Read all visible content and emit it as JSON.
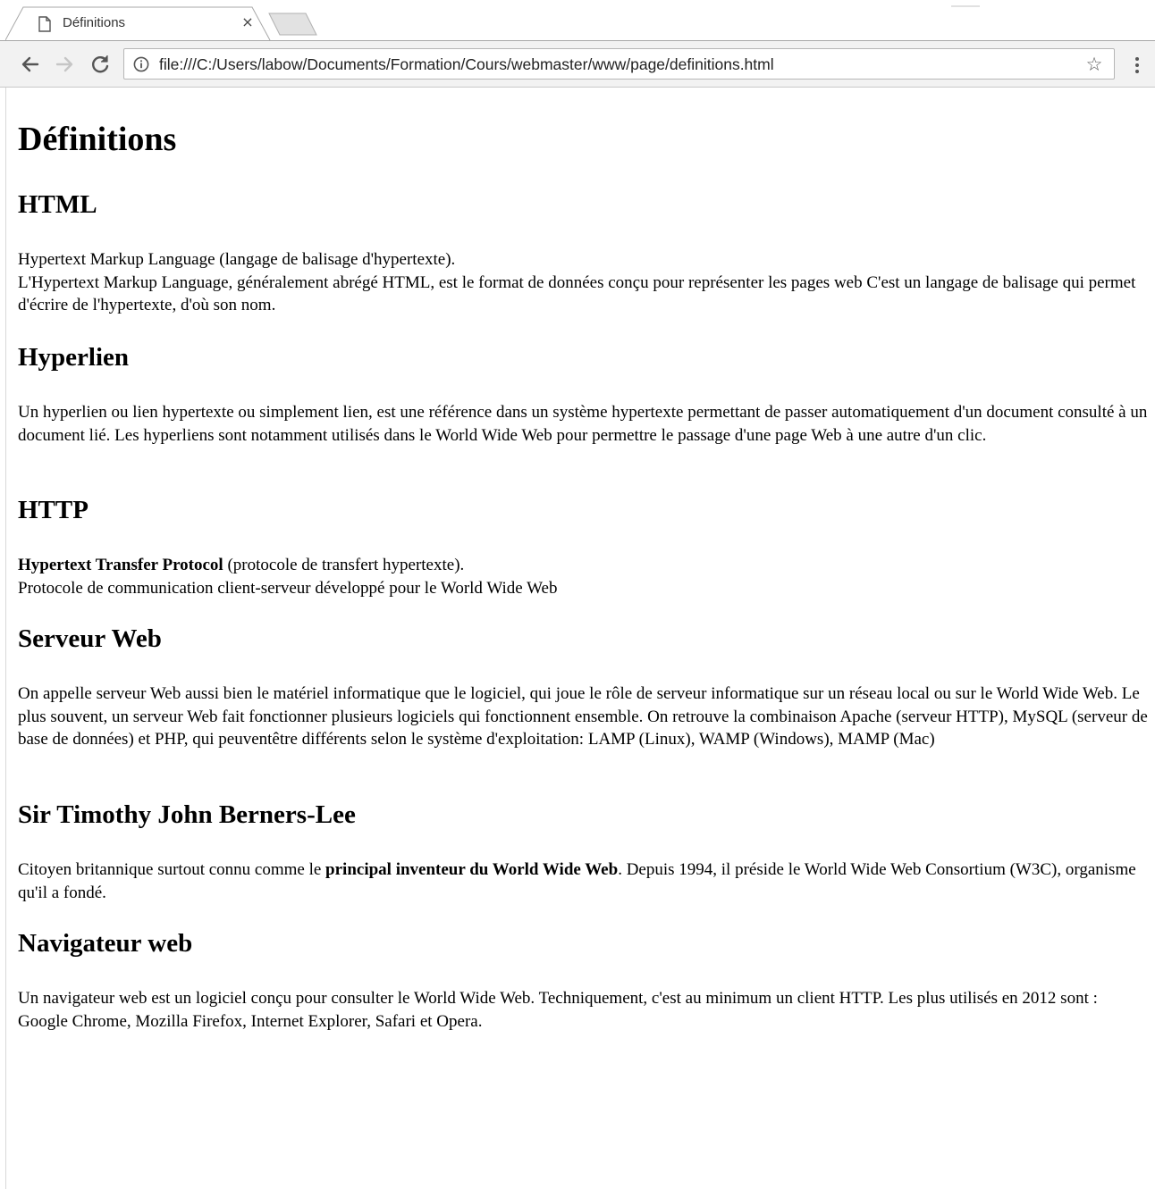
{
  "browser": {
    "tab_title": "Définitions",
    "tab_close": "×",
    "url": "file:///C:/Users/labow/Documents/Formation/Cours/webmaster/www/page/definitions.html",
    "icons": {
      "favicon": "document-icon",
      "back": "back-arrow-icon",
      "forward": "forward-arrow-icon",
      "reload": "reload-icon",
      "info": "info-icon",
      "bookmark": "star-icon",
      "menu": "kebab-menu-icon"
    }
  },
  "page": {
    "title": "Définitions",
    "sections": [
      {
        "heading": "HTML",
        "line1": "Hypertext Markup Language (langage de balisage d'hypertexte).",
        "line2": "L'Hypertext Markup Language, généralement abrégé HTML, est le format de données conçu pour représenter les pages web C'est un langage de balisage qui permet d'écrire de l'hypertexte, d'où son nom."
      },
      {
        "heading": "Hyperlien",
        "text": "Un hyperlien ou lien hypertexte ou simplement lien, est une référence dans un système hypertexte permettant de passer automatiquement d'un document consulté à un document lié. Les hyperliens sont notamment utilisés dans le World Wide Web pour permettre le passage d'une page Web à une autre d'un clic."
      },
      {
        "heading": "HTTP",
        "bold": "Hypertext Transfer Protocol",
        "line1_rest": " (protocole de transfert hypertexte).",
        "line2": "Protocole de communication client-serveur développé pour le World Wide Web"
      },
      {
        "heading": "Serveur Web",
        "text": "On appelle serveur Web aussi bien le matériel informatique que le logiciel, qui joue le rôle de serveur informatique sur un réseau local ou sur le World Wide Web. Le plus souvent, un serveur Web fait fonctionner plusieurs logiciels qui fonctionnent ensemble. On retrouve la combinaison Apache (serveur HTTP), MySQL (serveur de base de données) et PHP, qui peuventêtre différents selon le système d'exploitation: LAMP (Linux), WAMP (Windows), MAMP (Mac)"
      },
      {
        "heading": "Sir Timothy John Berners-Lee",
        "before": "Citoyen britannique surtout connu comme le ",
        "bold": "principal inventeur du World Wide Web",
        "after": ". Depuis 1994, il préside le World Wide Web Consortium (W3C), organisme qu'il a fondé."
      },
      {
        "heading": "Navigateur web",
        "text": "Un navigateur web est un logiciel conçu pour consulter le World Wide Web. Techniquement, c'est au minimum un client HTTP. Les plus utilisés en 2012 sont : Google Chrome, Mozilla Firefox, Internet Explorer, Safari et Opera."
      }
    ]
  }
}
